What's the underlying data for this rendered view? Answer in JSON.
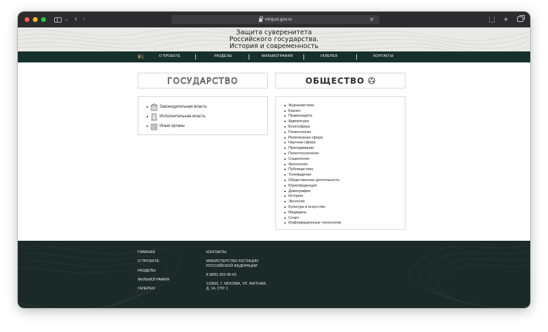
{
  "browser": {
    "url": "minjust.gov.ru"
  },
  "site": {
    "title_lines": [
      "Защита суверенитета",
      "Российского государства.",
      "История и современность"
    ],
    "nav": [
      "О ПРОЕКТЕ",
      "РАЗДЕЛЫ",
      "ФИЛЬМОГРАФИЯ",
      "ГАЛЕРЕЯ",
      "КОНТАКТЫ"
    ]
  },
  "state": {
    "heading": "ГОСУДАРСТВО",
    "items": [
      {
        "label": "Законодательная власть",
        "icon": "parliament-icon"
      },
      {
        "label": "Исполнительная власть",
        "icon": "government-building-icon"
      },
      {
        "label": "Иные органы",
        "icon": "institution-icon"
      }
    ]
  },
  "society": {
    "heading": "ОБЩЕСТВО",
    "items": [
      "Журналистика",
      "Бизнес",
      "Правозащита",
      "Адвокатура",
      "Блогосфера",
      "Политология",
      "Религиозная сфера",
      "Научная сфера",
      "Преподавание",
      "Политтехнологии",
      "Социология",
      "Филология",
      "Публицистика",
      "Телевидение",
      "Общественная деятельность",
      "Юриспруденция",
      "Демография",
      "История",
      "Экология",
      "Культура и искусство",
      "Медицина",
      "Спорт",
      "Информационные технологии"
    ]
  },
  "footer": {
    "col1": [
      "ГЛАВНАЯ",
      "О ПРОЕКТЕ",
      "РАЗДЕЛЫ",
      "ФИЛЬМОГРАФИЯ",
      "ГАЛЕРЕЯ"
    ],
    "contacts_heading": "КОНТАКТЫ",
    "ministry_lines": [
      "МИНИСТЕРСТВО ЮСТИЦИИ",
      "РОССИЙСКОЙ ФЕДЕРАЦИИ"
    ],
    "phone": "8 (800) 303-30-03",
    "address_lines": [
      "119991, Г. МОСКВА, УЛ. ЖИТНАЯ,",
      "Д. 14, СТР. 1"
    ]
  },
  "colors": {
    "nav_bg": "#16302c",
    "footer_bg": "#1b2a28",
    "hero_bg": "#e9e9e7"
  }
}
